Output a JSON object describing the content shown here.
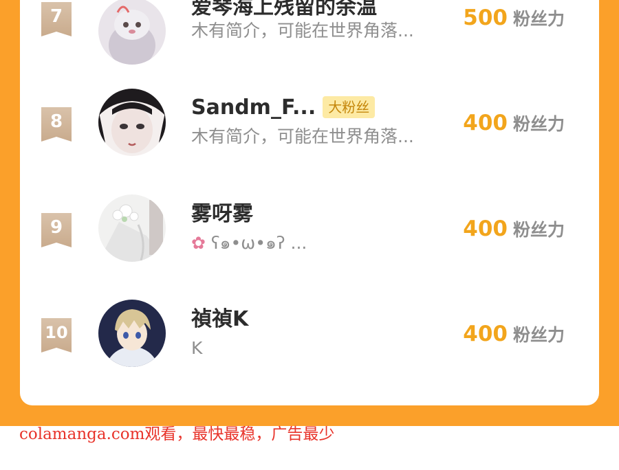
{
  "ranking": {
    "rows": [
      {
        "rank": "7",
        "name": "爱琴海上残留的余温",
        "badge": "",
        "bio": "木有简介，可能在世界角落...",
        "score": "500",
        "unit": "粉丝力",
        "avatar_icon": "plush-toy-avatar"
      },
      {
        "rank": "8",
        "name": "Sandm_F...",
        "badge": "大粉丝",
        "bio": "木有简介，可能在世界角落...",
        "score": "400",
        "unit": "粉丝力",
        "avatar_icon": "anime-girl-avatar"
      },
      {
        "rank": "9",
        "name": "雾呀雾",
        "badge": "",
        "bio_icon": "cherry-blossom-icon",
        "bio": "ʕ๑•ω•๑ʔ ...",
        "score": "400",
        "unit": "粉丝力",
        "avatar_icon": "white-flowers-avatar"
      },
      {
        "rank": "10",
        "name": "禎禎K",
        "badge": "",
        "bio": "K",
        "score": "400",
        "unit": "粉丝力",
        "avatar_icon": "anime-boy-avatar"
      }
    ]
  },
  "watermark": "colamanga.com观看，最快最稳，广告最少",
  "colors": {
    "accent_orange": "#fba02a",
    "score_gold": "#f2a51c",
    "rank_flag": "#d2b89d",
    "badge_bg": "#fdeaa4",
    "watermark_red": "#e8332a"
  }
}
